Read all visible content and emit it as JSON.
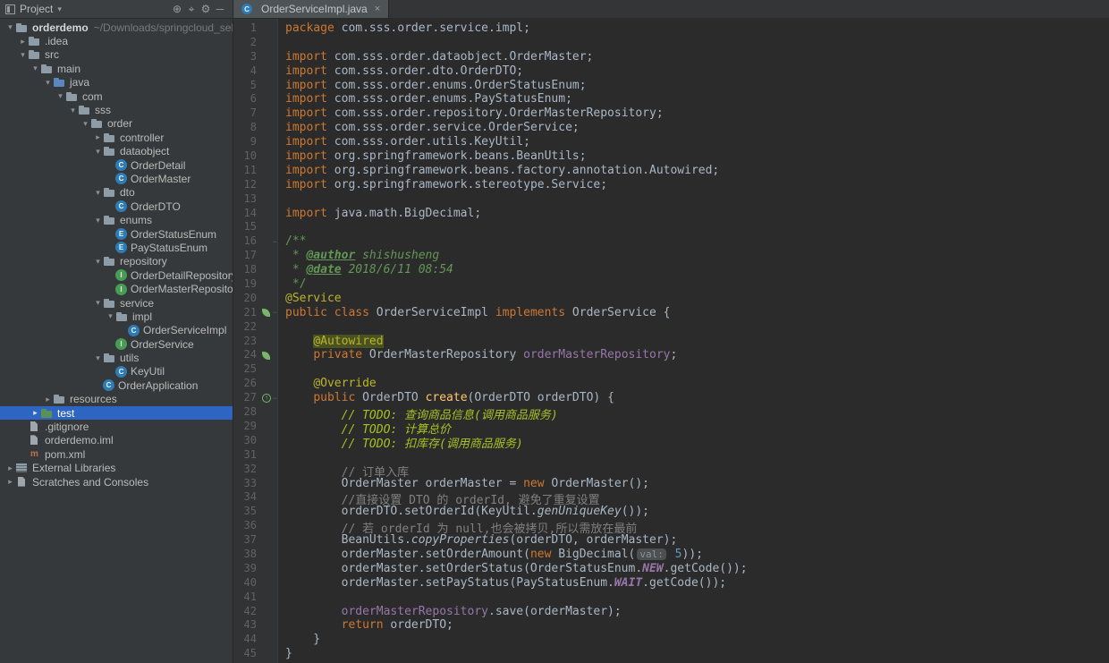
{
  "colors": {
    "editor_bg": "#2B2B2B",
    "sidebar_bg": "#36393B",
    "header_bg": "#3C3F41",
    "selection_blue": "#2E65C2",
    "keyword_orange": "#CC7832",
    "annotation_yellow": "#BBB529",
    "comment_gray": "#808080",
    "doc_comment_green": "#629755",
    "todo_green": "#A8C023",
    "field_purple": "#9876AA",
    "number_blue": "#6897BB",
    "method_yellow": "#FFC66D",
    "line_number_gray": "#606366",
    "plain_text": "#A9B7C6",
    "spring_bean_green": "#77B767"
  },
  "project_panel": {
    "title": "Project",
    "icons": [
      {
        "name": "expand-icon",
        "glyph": "⊕"
      },
      {
        "name": "locate-icon",
        "glyph": "⌖"
      },
      {
        "name": "settings-icon",
        "glyph": "⚙"
      },
      {
        "name": "hide-icon",
        "glyph": "─"
      }
    ]
  },
  "project_tree": {
    "items": [
      {
        "label": "orderdemo",
        "extra": "~/Downloads/springcloud_sell/ord",
        "icon": "folder",
        "indent": 0,
        "chevron": "open",
        "bold": true
      },
      {
        "label": ".idea",
        "icon": "folder",
        "indent": 1,
        "chevron": "closed"
      },
      {
        "label": "src",
        "icon": "folder",
        "indent": 1,
        "chevron": "open"
      },
      {
        "label": "main",
        "icon": "folder",
        "indent": 2,
        "chevron": "open"
      },
      {
        "label": "java",
        "icon": "source-folder",
        "indent": 3,
        "chevron": "open"
      },
      {
        "label": "com",
        "icon": "package",
        "indent": 4,
        "chevron": "open"
      },
      {
        "label": "sss",
        "icon": "package",
        "indent": 5,
        "chevron": "open"
      },
      {
        "label": "order",
        "icon": "package",
        "indent": 6,
        "chevron": "open"
      },
      {
        "label": "controller",
        "icon": "package",
        "indent": 7,
        "chevron": "closed"
      },
      {
        "label": "dataobject",
        "icon": "package",
        "indent": 7,
        "chevron": "open"
      },
      {
        "label": "OrderDetail",
        "icon": "class",
        "indent": 8
      },
      {
        "label": "OrderMaster",
        "icon": "class",
        "indent": 8
      },
      {
        "label": "dto",
        "icon": "package",
        "indent": 7,
        "chevron": "open"
      },
      {
        "label": "OrderDTO",
        "icon": "class",
        "indent": 8
      },
      {
        "label": "enums",
        "icon": "package",
        "indent": 7,
        "chevron": "open"
      },
      {
        "label": "OrderStatusEnum",
        "icon": "enum",
        "indent": 8
      },
      {
        "label": "PayStatusEnum",
        "icon": "enum",
        "indent": 8
      },
      {
        "label": "repository",
        "icon": "package",
        "indent": 7,
        "chevron": "open"
      },
      {
        "label": "OrderDetailRepository",
        "icon": "interface",
        "indent": 8
      },
      {
        "label": "OrderMasterRepository",
        "icon": "interface",
        "indent": 8
      },
      {
        "label": "service",
        "icon": "package",
        "indent": 7,
        "chevron": "open"
      },
      {
        "label": "impl",
        "icon": "package",
        "indent": 8,
        "chevron": "open"
      },
      {
        "label": "OrderServiceImpl",
        "icon": "class",
        "indent": 9
      },
      {
        "label": "OrderService",
        "icon": "interface",
        "indent": 8
      },
      {
        "label": "utils",
        "icon": "package",
        "indent": 7,
        "chevron": "open"
      },
      {
        "label": "KeyUtil",
        "icon": "class",
        "indent": 8
      },
      {
        "label": "OrderApplication",
        "icon": "class",
        "indent": 7
      },
      {
        "label": "resources",
        "icon": "folder",
        "indent": 3,
        "chevron": "closed"
      },
      {
        "label": "test",
        "icon": "test-folder",
        "indent": 2,
        "chevron": "closed",
        "selected": true
      },
      {
        "label": ".gitignore",
        "icon": "file",
        "indent": 1
      },
      {
        "label": "orderdemo.iml",
        "icon": "file",
        "indent": 1
      },
      {
        "label": "pom.xml",
        "icon": "maven",
        "indent": 1
      },
      {
        "label": "External Libraries",
        "icon": "library",
        "indent": 0,
        "chevron": "closed"
      },
      {
        "label": "Scratches and Consoles",
        "icon": "scratches",
        "indent": 0,
        "chevron": "closed"
      }
    ]
  },
  "editor": {
    "tab_title": "OrderServiceImpl.java",
    "close_glyph": "×",
    "gutter_icons": [
      {
        "line": 21,
        "type": "spring-bean"
      },
      {
        "line": 24,
        "type": "spring-bean"
      },
      {
        "line": 27,
        "type": "override"
      }
    ],
    "fold_lines": [
      16,
      21,
      27
    ],
    "lines": [
      {
        "n": 1,
        "s": [
          [
            "k",
            "package"
          ],
          [
            "p",
            " com.sss.order.service.impl;"
          ]
        ]
      },
      {
        "n": 2,
        "s": []
      },
      {
        "n": 3,
        "s": [
          [
            "k",
            "import"
          ],
          [
            "p",
            " com.sss.order.dataobject.OrderMaster;"
          ]
        ]
      },
      {
        "n": 4,
        "s": [
          [
            "k",
            "import"
          ],
          [
            "p",
            " com.sss.order.dto.OrderDTO;"
          ]
        ]
      },
      {
        "n": 5,
        "s": [
          [
            "k",
            "import"
          ],
          [
            "p",
            " com.sss.order.enums.OrderStatusEnum;"
          ]
        ]
      },
      {
        "n": 6,
        "s": [
          [
            "k",
            "import"
          ],
          [
            "p",
            " com.sss.order.enums.PayStatusEnum;"
          ]
        ]
      },
      {
        "n": 7,
        "s": [
          [
            "k",
            "import"
          ],
          [
            "p",
            " com.sss.order.repository.OrderMasterRepository;"
          ]
        ]
      },
      {
        "n": 8,
        "s": [
          [
            "k",
            "import"
          ],
          [
            "p",
            " com.sss.order.service.OrderService;"
          ]
        ]
      },
      {
        "n": 9,
        "s": [
          [
            "k",
            "import"
          ],
          [
            "p",
            " com.sss.order.utils.KeyUtil;"
          ]
        ]
      },
      {
        "n": 10,
        "s": [
          [
            "k",
            "import"
          ],
          [
            "p",
            " org.springframework.beans.BeanUtils;"
          ]
        ]
      },
      {
        "n": 11,
        "s": [
          [
            "k",
            "import"
          ],
          [
            "p",
            " org.springframework.beans.factory.annotation.Autowired;"
          ]
        ]
      },
      {
        "n": 12,
        "s": [
          [
            "k",
            "import"
          ],
          [
            "p",
            " org.springframework.stereotype.Service;"
          ]
        ]
      },
      {
        "n": 13,
        "s": []
      },
      {
        "n": 14,
        "s": [
          [
            "k",
            "import"
          ],
          [
            "p",
            " java.math.BigDecimal;"
          ]
        ]
      },
      {
        "n": 15,
        "s": []
      },
      {
        "n": 16,
        "s": [
          [
            "d",
            "/**"
          ]
        ]
      },
      {
        "n": 17,
        "s": [
          [
            "d",
            " * "
          ],
          [
            "dt",
            "@author"
          ],
          [
            "di",
            " shishusheng"
          ]
        ]
      },
      {
        "n": 18,
        "s": [
          [
            "d",
            " * "
          ],
          [
            "dt",
            "@date"
          ],
          [
            "di",
            " 2018/6/11 08:54"
          ]
        ]
      },
      {
        "n": 19,
        "s": [
          [
            "d",
            " */"
          ]
        ]
      },
      {
        "n": 20,
        "s": [
          [
            "a",
            "@Service"
          ]
        ]
      },
      {
        "n": 21,
        "s": [
          [
            "k",
            "public class "
          ],
          [
            "p",
            "OrderServiceImpl "
          ],
          [
            "k",
            "implements"
          ],
          [
            "p",
            " OrderService {"
          ]
        ]
      },
      {
        "n": 22,
        "s": []
      },
      {
        "n": 23,
        "s": [
          [
            "p",
            "    "
          ],
          [
            "ah",
            "@Autowired"
          ]
        ]
      },
      {
        "n": 24,
        "s": [
          [
            "p",
            "    "
          ],
          [
            "k",
            "private"
          ],
          [
            "p",
            " OrderMasterRepository "
          ],
          [
            "f",
            "orderMasterRepository"
          ],
          [
            "p",
            ";"
          ]
        ]
      },
      {
        "n": 25,
        "s": []
      },
      {
        "n": 26,
        "s": [
          [
            "p",
            "    "
          ],
          [
            "a",
            "@Override"
          ]
        ]
      },
      {
        "n": 27,
        "s": [
          [
            "p",
            "    "
          ],
          [
            "k",
            "public"
          ],
          [
            "p",
            " OrderDTO "
          ],
          [
            "md",
            "create"
          ],
          [
            "p",
            "(OrderDTO orderDTO) {"
          ]
        ]
      },
      {
        "n": 28,
        "s": [
          [
            "t",
            "        // TODO: 查询商品信息(调用商品服务)"
          ]
        ]
      },
      {
        "n": 29,
        "s": [
          [
            "t",
            "        // TODO: 计算总价"
          ]
        ]
      },
      {
        "n": 30,
        "s": [
          [
            "t",
            "        // TODO: 扣库存(调用商品服务)"
          ]
        ]
      },
      {
        "n": 31,
        "s": []
      },
      {
        "n": 32,
        "s": [
          [
            "c",
            "        // 订单入库"
          ]
        ]
      },
      {
        "n": 33,
        "s": [
          [
            "p",
            "        OrderMaster orderMaster = "
          ],
          [
            "k",
            "new"
          ],
          [
            "p",
            " OrderMaster();"
          ]
        ]
      },
      {
        "n": 34,
        "s": [
          [
            "c",
            "        //直接设置 DTO 的 orderId, 避免了重复设置"
          ]
        ]
      },
      {
        "n": 35,
        "s": [
          [
            "p",
            "        orderDTO.setOrderId(KeyUtil."
          ],
          [
            "sm",
            "genUniqueKey"
          ],
          [
            "p",
            "());"
          ]
        ]
      },
      {
        "n": 36,
        "s": [
          [
            "c",
            "        // 若 orderId 为 null,也会被拷贝,所以需放在最前"
          ]
        ]
      },
      {
        "n": 37,
        "s": [
          [
            "p",
            "        BeanUtils."
          ],
          [
            "sm",
            "copyProperties"
          ],
          [
            "p",
            "(orderDTO, orderMaster);"
          ]
        ]
      },
      {
        "n": 38,
        "s": [
          [
            "p",
            "        orderMaster.setOrderAmount("
          ],
          [
            "k",
            "new"
          ],
          [
            "p",
            " BigDecimal("
          ],
          [
            "il",
            "val:"
          ],
          [
            "p",
            " "
          ],
          [
            "num",
            "5"
          ],
          [
            "p",
            "));"
          ]
        ]
      },
      {
        "n": 39,
        "s": [
          [
            "p",
            "        orderMaster.setOrderStatus(OrderStatusEnum."
          ],
          [
            "cn",
            "NEW"
          ],
          [
            "p",
            ".getCode());"
          ]
        ]
      },
      {
        "n": 40,
        "s": [
          [
            "p",
            "        orderMaster.setPayStatus(PayStatusEnum."
          ],
          [
            "cn",
            "WAIT"
          ],
          [
            "p",
            ".getCode());"
          ]
        ]
      },
      {
        "n": 41,
        "s": []
      },
      {
        "n": 42,
        "s": [
          [
            "p",
            "        "
          ],
          [
            "f",
            "orderMasterRepository"
          ],
          [
            "p",
            ".save(orderMaster);"
          ]
        ]
      },
      {
        "n": 43,
        "s": [
          [
            "p",
            "        "
          ],
          [
            "k",
            "return"
          ],
          [
            "p",
            " orderDTO;"
          ]
        ]
      },
      {
        "n": 44,
        "s": [
          [
            "p",
            "    }"
          ]
        ]
      },
      {
        "n": 45,
        "s": [
          [
            "p",
            "}"
          ]
        ]
      }
    ]
  }
}
